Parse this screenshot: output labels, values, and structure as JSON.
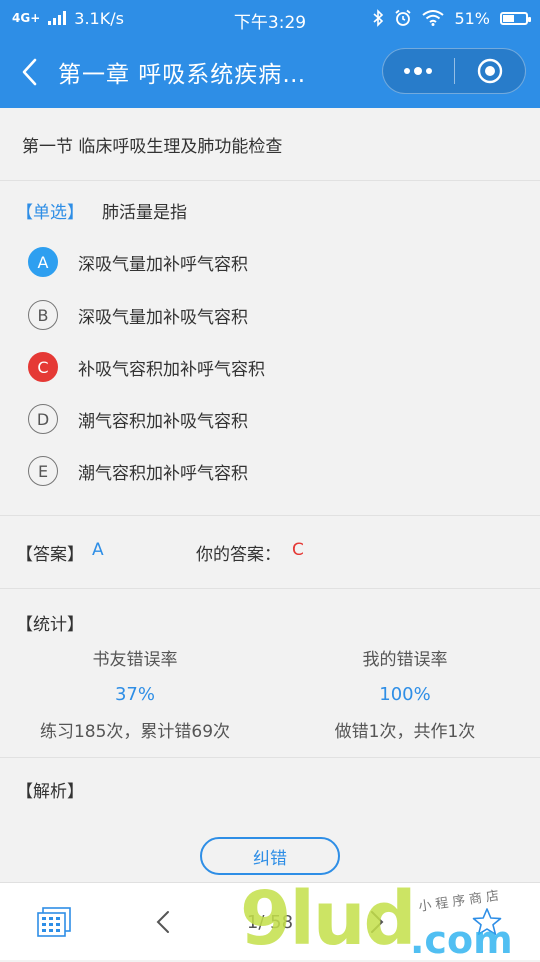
{
  "status_bar": {
    "network": "4G+",
    "speed": "3.1K/s",
    "time": "下午3:29",
    "battery": "51%",
    "battery_level": 0.51
  },
  "nav": {
    "title": "第一章 呼吸系统疾病…"
  },
  "chapter": "第一节 临床呼吸生理及肺功能检查",
  "question": {
    "type_tag": "【单选】",
    "text": "肺活量是指",
    "options": [
      {
        "letter": "A",
        "text": "深吸气量加补呼气容积",
        "state": "correct"
      },
      {
        "letter": "B",
        "text": "深吸气量加补吸气容积",
        "state": "normal"
      },
      {
        "letter": "C",
        "text": "补吸气容积加补呼气容积",
        "state": "wrong"
      },
      {
        "letter": "D",
        "text": "潮气容积加补吸气容积",
        "state": "normal"
      },
      {
        "letter": "E",
        "text": "潮气容积加补呼气容积",
        "state": "normal"
      }
    ]
  },
  "answer": {
    "label": "【答案】",
    "correct": "A",
    "user_label": "你的答案：",
    "user": "C"
  },
  "stats": {
    "title": "【统计】",
    "friends": {
      "label": "书友错误率",
      "pct": "37%",
      "detail": "练习185次，累计错69次"
    },
    "mine": {
      "label": "我的错误率",
      "pct": "100%",
      "detail": "做错1次，共作1次"
    }
  },
  "analysis": {
    "title": "【解析】",
    "correct_button": "纠错"
  },
  "bottom": {
    "page": "1/ 58"
  },
  "watermark": {
    "main": "9lud",
    "suffix": ".com",
    "small": "小程序商店"
  },
  "colors": {
    "primary": "#2e8ee6",
    "correct": "#2e9ff0",
    "wrong": "#e53935"
  }
}
